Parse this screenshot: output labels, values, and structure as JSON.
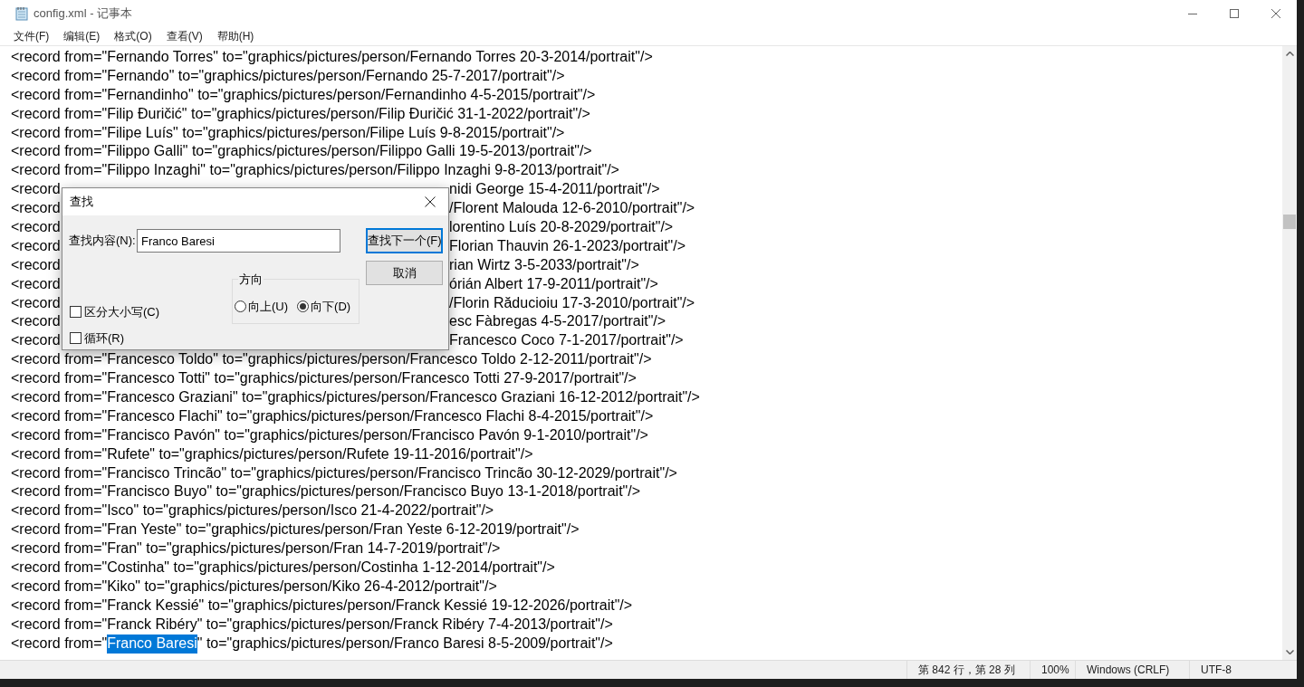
{
  "window": {
    "title": "config.xml - 记事本"
  },
  "menu": [
    "文件(F)",
    "编辑(E)",
    "格式(O)",
    "查看(V)",
    "帮助(H)"
  ],
  "lines": [
    {
      "kind": "plain",
      "text": "<record from=\"Fernando Torres\" to=\"graphics/pictures/person/Fernando Torres 20-3-2014/portrait\"/>"
    },
    {
      "kind": "plain",
      "text": "<record from=\"Fernando\" to=\"graphics/pictures/person/Fernando 25-7-2017/portrait\"/>"
    },
    {
      "kind": "plain",
      "text": "<record from=\"Fernandinho\" to=\"graphics/pictures/person/Fernandinho 4-5-2015/portrait\"/>"
    },
    {
      "kind": "plain",
      "text": "<record from=\"Filip Đuričić\" to=\"graphics/pictures/person/Filip Đuričić 31-1-2022/portrait\"/>"
    },
    {
      "kind": "plain",
      "text": "<record from=\"Filipe Luís\" to=\"graphics/pictures/person/Filipe Luís 9-8-2015/portrait\"/>"
    },
    {
      "kind": "plain",
      "text": "<record from=\"Filippo Galli\" to=\"graphics/pictures/person/Filippo Galli 19-5-2013/portrait\"/>"
    },
    {
      "kind": "plain",
      "text": "<record from=\"Filippo Inzaghi\" to=\"graphics/pictures/person/Filippo Inzaghi 9-8-2013/portrait\"/>"
    },
    {
      "kind": "covered",
      "left": "<record",
      "right": "nidi George 15-4-2011/portrait\"/>"
    },
    {
      "kind": "covered",
      "left": "<record",
      "right": "/Florent Malouda 12-6-2010/portrait\"/>"
    },
    {
      "kind": "covered",
      "left": "<record",
      "right": "lorentino Luís 20-8-2029/portrait\"/>"
    },
    {
      "kind": "covered",
      "left": "<record",
      "right": "Florian Thauvin 26-1-2023/portrait\"/>"
    },
    {
      "kind": "covered",
      "left": "<record",
      "right": "rian Wirtz 3-5-2033/portrait\"/>"
    },
    {
      "kind": "covered",
      "left": "<record",
      "right": "órián Albert 17-9-2011/portrait\"/>"
    },
    {
      "kind": "covered",
      "left": "<record",
      "right": "/Florin Răducioiu 17-3-2010/portrait\"/>"
    },
    {
      "kind": "covered",
      "left": "<record",
      "right": "esc Fàbregas 4-5-2017/portrait\"/>"
    },
    {
      "kind": "covered",
      "left": "<record",
      "right": "Francesco Coco 7-1-2017/portrait\"/>"
    },
    {
      "kind": "plain",
      "text": "<record from=\"Francesco Toldo\" to=\"graphics/pictures/person/Francesco Toldo 2-12-2011/portrait\"/>"
    },
    {
      "kind": "plain",
      "text": "<record from=\"Francesco Totti\" to=\"graphics/pictures/person/Francesco Totti 27-9-2017/portrait\"/>"
    },
    {
      "kind": "plain",
      "text": "<record from=\"Francesco Graziani\" to=\"graphics/pictures/person/Francesco Graziani 16-12-2012/portrait\"/>"
    },
    {
      "kind": "plain",
      "text": "<record from=\"Francesco Flachi\" to=\"graphics/pictures/person/Francesco Flachi 8-4-2015/portrait\"/>"
    },
    {
      "kind": "plain",
      "text": "<record from=\"Francisco Pavón\" to=\"graphics/pictures/person/Francisco Pavón 9-1-2010/portrait\"/>"
    },
    {
      "kind": "plain",
      "text": "<record from=\"Rufete\" to=\"graphics/pictures/person/Rufete 19-11-2016/portrait\"/>"
    },
    {
      "kind": "plain",
      "text": "<record from=\"Francisco Trincão\" to=\"graphics/pictures/person/Francisco Trincão 30-12-2029/portrait\"/>"
    },
    {
      "kind": "plain",
      "text": "<record from=\"Francisco Buyo\" to=\"graphics/pictures/person/Francisco Buyo 13-1-2018/portrait\"/>"
    },
    {
      "kind": "plain",
      "text": "<record from=\"Isco\" to=\"graphics/pictures/person/Isco 21-4-2022/portrait\"/>"
    },
    {
      "kind": "plain",
      "text": "<record from=\"Fran Yeste\" to=\"graphics/pictures/person/Fran Yeste 6-12-2019/portrait\"/>"
    },
    {
      "kind": "plain",
      "text": "<record from=\"Fran\" to=\"graphics/pictures/person/Fran 14-7-2019/portrait\"/>"
    },
    {
      "kind": "plain",
      "text": "<record from=\"Costinha\" to=\"graphics/pictures/person/Costinha 1-12-2014/portrait\"/>"
    },
    {
      "kind": "plain",
      "text": "<record from=\"Kiko\" to=\"graphics/pictures/person/Kiko 26-4-2012/portrait\"/>"
    },
    {
      "kind": "plain",
      "text": "<record from=\"Franck Kessié\" to=\"graphics/pictures/person/Franck Kessié 19-12-2026/portrait\"/>"
    },
    {
      "kind": "plain",
      "text": "<record from=\"Franck Ribéry\" to=\"graphics/pictures/person/Franck Ribéry 7-4-2013/portrait\"/>"
    },
    {
      "kind": "selection",
      "before": "<record from=\"",
      "selected": "Franco Baresi",
      "after": "\" to=\"graphics/pictures/person/Franco Baresi 8-5-2009/portrait\"/>"
    }
  ],
  "find_dialog": {
    "title": "查找",
    "find_label": "查找内容(N):",
    "find_value": "Franco Baresi",
    "find_next": "查找下一个(F)",
    "cancel": "取消",
    "direction_label": "方向",
    "directions": [
      {
        "label": "向上(U)",
        "selected": false
      },
      {
        "label": "向下(D)",
        "selected": true
      }
    ],
    "options": [
      {
        "label": "区分大小写(C)",
        "checked": false
      },
      {
        "label": "循环(R)",
        "checked": false
      }
    ]
  },
  "status_bar": [
    "第 842 行，第 28 列",
    "100%",
    "Windows (CRLF)",
    "UTF-8"
  ]
}
